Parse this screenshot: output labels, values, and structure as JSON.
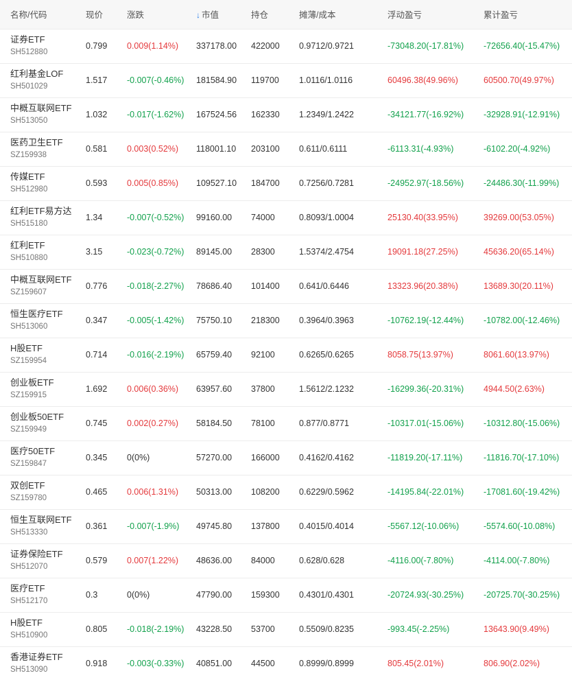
{
  "header": {
    "name_code": "名称/代码",
    "price": "现价",
    "change": "涨跌",
    "market_value": "市值",
    "position": "持仓",
    "cost": "摊薄/成本",
    "floating_pl": "浮动盈亏",
    "cumulative_pl": "累计盈亏",
    "sort_icon": "arrow-down-icon"
  },
  "colors": {
    "gain": "#e4393c",
    "loss": "#12a14c",
    "sort_accent": "#2b7de9"
  },
  "rows": [
    {
      "name": "证券ETF",
      "code": "SH512880",
      "price": "0.799",
      "change": "0.009(1.14%)",
      "change_dir": "up",
      "market_value": "337178.00",
      "position": "422000",
      "cost": "0.9712/0.9721",
      "floating": "-73048.20(-17.81%)",
      "floating_dir": "down",
      "cumulative": "-72656.40(-15.47%)",
      "cumulative_dir": "down"
    },
    {
      "name": "红利基金LOF",
      "code": "SH501029",
      "price": "1.517",
      "change": "-0.007(-0.46%)",
      "change_dir": "down",
      "market_value": "181584.90",
      "position": "119700",
      "cost": "1.0116/1.0116",
      "floating": "60496.38(49.96%)",
      "floating_dir": "up",
      "cumulative": "60500.70(49.97%)",
      "cumulative_dir": "up"
    },
    {
      "name": "中概互联网ETF",
      "code": "SH513050",
      "price": "1.032",
      "change": "-0.017(-1.62%)",
      "change_dir": "down",
      "market_value": "167524.56",
      "position": "162330",
      "cost": "1.2349/1.2422",
      "floating": "-34121.77(-16.92%)",
      "floating_dir": "down",
      "cumulative": "-32928.91(-12.91%)",
      "cumulative_dir": "down"
    },
    {
      "name": "医药卫生ETF",
      "code": "SZ159938",
      "price": "0.581",
      "change": "0.003(0.52%)",
      "change_dir": "up",
      "market_value": "118001.10",
      "position": "203100",
      "cost": "0.611/0.6111",
      "floating": "-6113.31(-4.93%)",
      "floating_dir": "down",
      "cumulative": "-6102.20(-4.92%)",
      "cumulative_dir": "down"
    },
    {
      "name": "传媒ETF",
      "code": "SH512980",
      "price": "0.593",
      "change": "0.005(0.85%)",
      "change_dir": "up",
      "market_value": "109527.10",
      "position": "184700",
      "cost": "0.7256/0.7281",
      "floating": "-24952.97(-18.56%)",
      "floating_dir": "down",
      "cumulative": "-24486.30(-11.99%)",
      "cumulative_dir": "down"
    },
    {
      "name": "红利ETF易方达",
      "code": "SH515180",
      "price": "1.34",
      "change": "-0.007(-0.52%)",
      "change_dir": "down",
      "market_value": "99160.00",
      "position": "74000",
      "cost": "0.8093/1.0004",
      "floating": "25130.40(33.95%)",
      "floating_dir": "up",
      "cumulative": "39269.00(53.05%)",
      "cumulative_dir": "up"
    },
    {
      "name": "红利ETF",
      "code": "SH510880",
      "price": "3.15",
      "change": "-0.023(-0.72%)",
      "change_dir": "down",
      "market_value": "89145.00",
      "position": "28300",
      "cost": "1.5374/2.4754",
      "floating": "19091.18(27.25%)",
      "floating_dir": "up",
      "cumulative": "45636.20(65.14%)",
      "cumulative_dir": "up"
    },
    {
      "name": "中概互联网ETF",
      "code": "SZ159607",
      "price": "0.776",
      "change": "-0.018(-2.27%)",
      "change_dir": "down",
      "market_value": "78686.40",
      "position": "101400",
      "cost": "0.641/0.6446",
      "floating": "13323.96(20.38%)",
      "floating_dir": "up",
      "cumulative": "13689.30(20.11%)",
      "cumulative_dir": "up"
    },
    {
      "name": "恒生医疗ETF",
      "code": "SH513060",
      "price": "0.347",
      "change": "-0.005(-1.42%)",
      "change_dir": "down",
      "market_value": "75750.10",
      "position": "218300",
      "cost": "0.3964/0.3963",
      "floating": "-10762.19(-12.44%)",
      "floating_dir": "down",
      "cumulative": "-10782.00(-12.46%)",
      "cumulative_dir": "down"
    },
    {
      "name": "H股ETF",
      "code": "SZ159954",
      "price": "0.714",
      "change": "-0.016(-2.19%)",
      "change_dir": "down",
      "market_value": "65759.40",
      "position": "92100",
      "cost": "0.6265/0.6265",
      "floating": "8058.75(13.97%)",
      "floating_dir": "up",
      "cumulative": "8061.60(13.97%)",
      "cumulative_dir": "up"
    },
    {
      "name": "创业板ETF",
      "code": "SZ159915",
      "price": "1.692",
      "change": "0.006(0.36%)",
      "change_dir": "up",
      "market_value": "63957.60",
      "position": "37800",
      "cost": "1.5612/2.1232",
      "floating": "-16299.36(-20.31%)",
      "floating_dir": "down",
      "cumulative": "4944.50(2.63%)",
      "cumulative_dir": "up"
    },
    {
      "name": "创业板50ETF",
      "code": "SZ159949",
      "price": "0.745",
      "change": "0.002(0.27%)",
      "change_dir": "up",
      "market_value": "58184.50",
      "position": "78100",
      "cost": "0.877/0.8771",
      "floating": "-10317.01(-15.06%)",
      "floating_dir": "down",
      "cumulative": "-10312.80(-15.06%)",
      "cumulative_dir": "down"
    },
    {
      "name": "医疗50ETF",
      "code": "SZ159847",
      "price": "0.345",
      "change": "0(0%)",
      "change_dir": "flat",
      "market_value": "57270.00",
      "position": "166000",
      "cost": "0.4162/0.4162",
      "floating": "-11819.20(-17.11%)",
      "floating_dir": "down",
      "cumulative": "-11816.70(-17.10%)",
      "cumulative_dir": "down"
    },
    {
      "name": "双创ETF",
      "code": "SZ159780",
      "price": "0.465",
      "change": "0.006(1.31%)",
      "change_dir": "up",
      "market_value": "50313.00",
      "position": "108200",
      "cost": "0.6229/0.5962",
      "floating": "-14195.84(-22.01%)",
      "floating_dir": "down",
      "cumulative": "-17081.60(-19.42%)",
      "cumulative_dir": "down"
    },
    {
      "name": "恒生互联网ETF",
      "code": "SH513330",
      "price": "0.361",
      "change": "-0.007(-1.9%)",
      "change_dir": "down",
      "market_value": "49745.80",
      "position": "137800",
      "cost": "0.4015/0.4014",
      "floating": "-5567.12(-10.06%)",
      "floating_dir": "down",
      "cumulative": "-5574.60(-10.08%)",
      "cumulative_dir": "down"
    },
    {
      "name": "证券保险ETF",
      "code": "SH512070",
      "price": "0.579",
      "change": "0.007(1.22%)",
      "change_dir": "up",
      "market_value": "48636.00",
      "position": "84000",
      "cost": "0.628/0.628",
      "floating": "-4116.00(-7.80%)",
      "floating_dir": "down",
      "cumulative": "-4114.00(-7.80%)",
      "cumulative_dir": "down"
    },
    {
      "name": "医疗ETF",
      "code": "SH512170",
      "price": "0.3",
      "change": "0(0%)",
      "change_dir": "flat",
      "market_value": "47790.00",
      "position": "159300",
      "cost": "0.4301/0.4301",
      "floating": "-20724.93(-30.25%)",
      "floating_dir": "down",
      "cumulative": "-20725.70(-30.25%)",
      "cumulative_dir": "down"
    },
    {
      "name": "H股ETF",
      "code": "SH510900",
      "price": "0.805",
      "change": "-0.018(-2.19%)",
      "change_dir": "down",
      "market_value": "43228.50",
      "position": "53700",
      "cost": "0.5509/0.8235",
      "floating": "-993.45(-2.25%)",
      "floating_dir": "down",
      "cumulative": "13643.90(9.49%)",
      "cumulative_dir": "up"
    },
    {
      "name": "香港证券ETF",
      "code": "SH513090",
      "price": "0.918",
      "change": "-0.003(-0.33%)",
      "change_dir": "down",
      "market_value": "40851.00",
      "position": "44500",
      "cost": "0.8999/0.8999",
      "floating": "805.45(2.01%)",
      "floating_dir": "up",
      "cumulative": "806.90(2.02%)",
      "cumulative_dir": "up"
    }
  ]
}
